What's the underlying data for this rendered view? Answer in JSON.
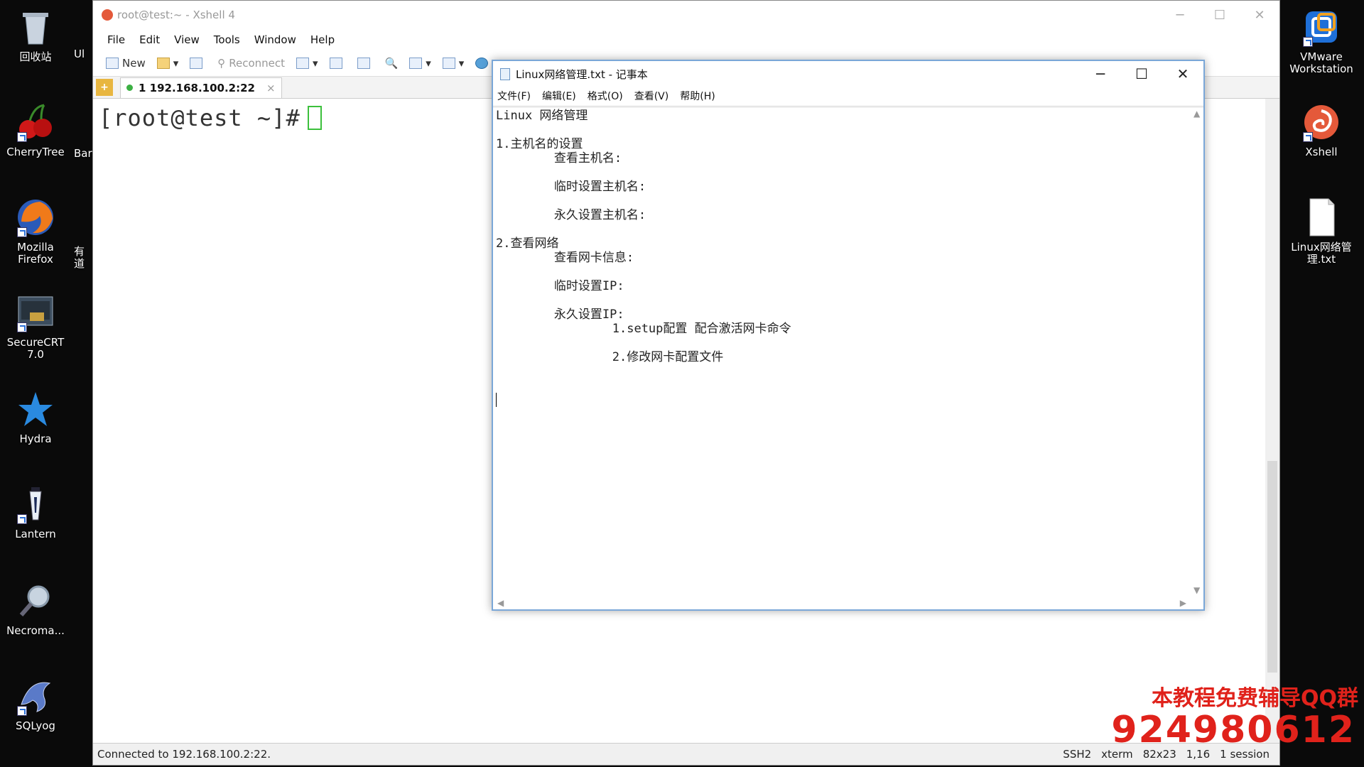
{
  "desktop": {
    "left_icons": [
      {
        "label": "回收站",
        "icon": "recycle-bin-icon"
      },
      {
        "label": "CherryTree",
        "icon": "cherry-icon"
      },
      {
        "label": "Mozilla Firefox",
        "icon": "firefox-icon"
      },
      {
        "label": "SecureCRT 7.0",
        "icon": "securecrt-icon"
      },
      {
        "label": "Hydra",
        "icon": "star-icon"
      },
      {
        "label": "Lantern",
        "icon": "lantern-icon"
      },
      {
        "label": "Necroma...",
        "icon": "magnifier-icon"
      },
      {
        "label": "SQLyog",
        "icon": "dolphin-icon"
      }
    ],
    "partial_icons": [
      "Ul",
      "Bar",
      "有道"
    ],
    "right_icons": [
      {
        "label": "VMware Workstation",
        "icon": "vmware-icon"
      },
      {
        "label": "Xshell",
        "icon": "xshell-icon"
      },
      {
        "label": "Linux网络管理.txt",
        "icon": "text-file-icon"
      }
    ]
  },
  "xshell": {
    "title": "root@test:~ - Xshell 4",
    "menu": [
      "File",
      "Edit",
      "View",
      "Tools",
      "Window",
      "Help"
    ],
    "toolbar": {
      "new_label": "New",
      "reconnect_label": "Reconnect"
    },
    "tab": {
      "label": "1 192.168.100.2:22",
      "close": "×"
    },
    "terminal": {
      "prompt": "[root@test ~]#"
    },
    "status": {
      "left": "Connected to 192.168.100.2:22.",
      "protocol": "SSH2",
      "term": "xterm",
      "size": "82x23",
      "pos": "1,16",
      "sessions": "1 session"
    }
  },
  "notepad": {
    "title": "Linux网络管理.txt - 记事本",
    "menu": [
      "文件(F)",
      "编辑(E)",
      "格式(O)",
      "查看(V)",
      "帮助(H)"
    ],
    "content": "Linux 网络管理\n\n1.主机名的设置\n        查看主机名:\n\n        临时设置主机名:\n\n        永久设置主机名:\n\n2.查看网络\n        查看网卡信息:\n\n        临时设置IP:\n\n        永久设置IP:\n                1.setup配置 配合激活网卡命令\n\n                2.修改网卡配置文件"
  },
  "watermark": {
    "line1": "本教程免费辅导QQ群",
    "line2": "924980612"
  }
}
